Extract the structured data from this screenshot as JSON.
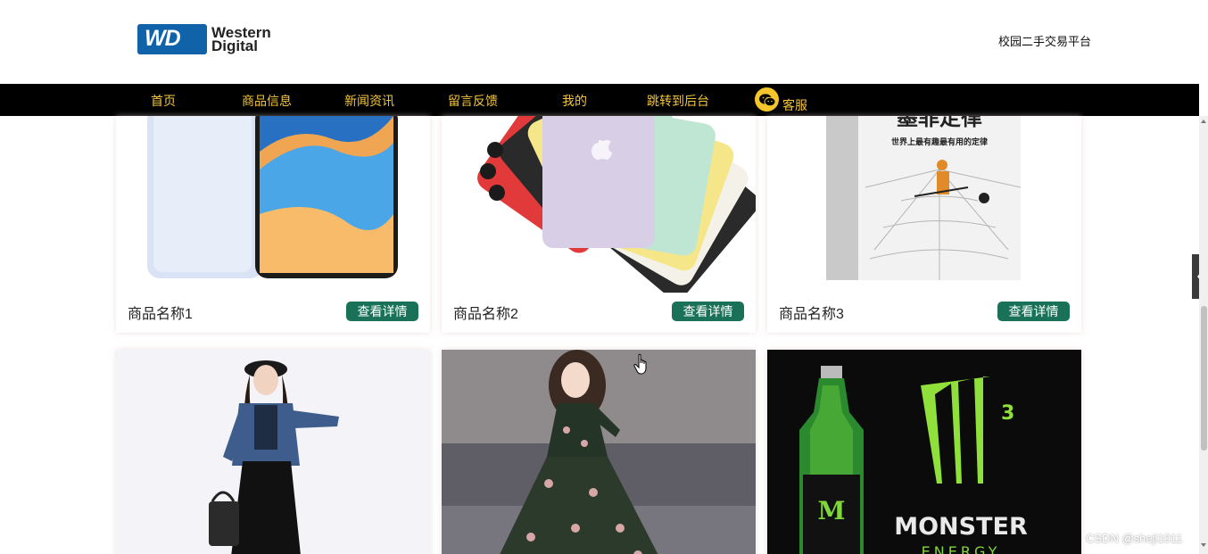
{
  "header": {
    "logo_badge": "WD",
    "logo_line1": "Western",
    "logo_line2": "Digital",
    "site_name": "校园二手交易平台"
  },
  "nav": {
    "items": [
      "首页",
      "商品信息",
      "新闻资讯",
      "留言反馈",
      "我的",
      "跳转到后台"
    ],
    "kefu": "客服"
  },
  "products": [
    {
      "name": "商品名称1",
      "button": "查看详情",
      "icon": "phone-image"
    },
    {
      "name": "商品名称2",
      "button": "查看详情",
      "icon": "iphone-image"
    },
    {
      "name": "商品名称3",
      "button": "查看详情",
      "icon": "book-image"
    },
    {
      "name": "",
      "button": "",
      "icon": "denim-jacket-image"
    },
    {
      "name": "",
      "button": "",
      "icon": "floral-dress-image"
    },
    {
      "name": "",
      "button": "",
      "icon": "monster-energy-image"
    }
  ],
  "book": {
    "title": "墨菲定律",
    "subtitle": "世界上最有趣最有用的定律"
  },
  "monster": {
    "logo": "M",
    "sup": "3",
    "brand": "MONSTER",
    "tagline": "ENERGY"
  },
  "watermark": "CSDN @sheji1011",
  "colors": {
    "nav_bg": "#000000",
    "nav_text": "#f2c53d",
    "button_bg": "#197257",
    "wd_blue": "#1062a9"
  }
}
